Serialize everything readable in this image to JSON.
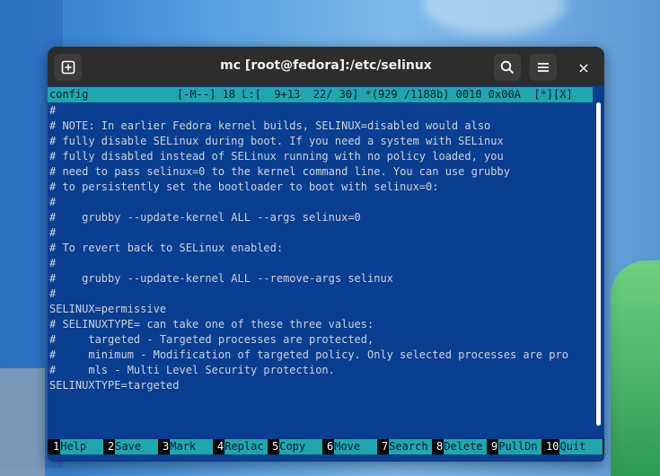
{
  "window": {
    "title": "mc [root@fedora]:/etc/selinux",
    "buttons": {
      "new_tab_icon": "plus-square-icon",
      "search_icon": "search-icon",
      "menu_icon": "hamburger-menu-icon",
      "close": "×"
    }
  },
  "editor": {
    "filename": "config",
    "status": "[-M--] 18 L:[  9+13  22/ 30] *(929 /1188b) 0010 0x00A  [*][X]",
    "lines": [
      "#",
      "# NOTE: In earlier Fedora kernel builds, SELINUX=disabled would also",
      "# fully disable SELinux during boot. If you need a system with SELinux",
      "# fully disabled instead of SELinux running with no policy loaded, you",
      "# need to pass selinux=0 to the kernel command line. You can use grubby",
      "# to persistently set the bootloader to boot with selinux=0:",
      "#",
      "#    grubby --update-kernel ALL --args selinux=0",
      "#",
      "# To revert back to SELinux enabled:",
      "#",
      "#    grubby --update-kernel ALL --remove-args selinux",
      "#",
      "SELINUX=permissive",
      "# SELINUXTYPE= can take one of these three values:",
      "#     targeted - Targeted processes are protected,",
      "#     minimum - Modification of targeted policy. Only selected processes are pro",
      "#     mls - Multi Level Security protection.",
      "SELINUXTYPE=targeted",
      "",
      "",
      ""
    ]
  },
  "fkeys": [
    {
      "num": "1",
      "label": "Help"
    },
    {
      "num": "2",
      "label": "Save"
    },
    {
      "num": "3",
      "label": "Mark"
    },
    {
      "num": "4",
      "label": "Replac"
    },
    {
      "num": "5",
      "label": "Copy"
    },
    {
      "num": "6",
      "label": "Move"
    },
    {
      "num": "7",
      "label": "Search"
    },
    {
      "num": "8",
      "label": "Delete"
    },
    {
      "num": "9",
      "label": "PullDn"
    },
    {
      "num": "10",
      "label": "Quit"
    }
  ]
}
